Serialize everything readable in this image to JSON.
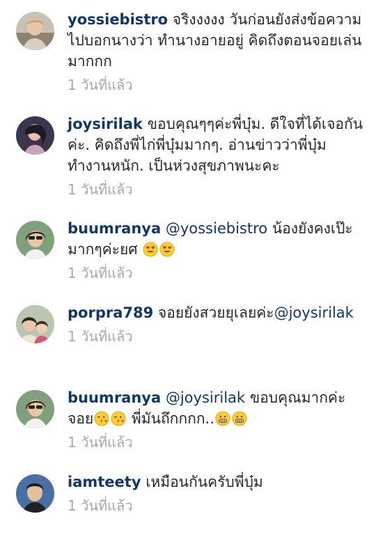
{
  "comments": [
    {
      "username": "yossiebistro",
      "mention": "",
      "text": "จริงงงงง วันก่อนยังส่งข้อความไปบอกนางว่า ทำนางอายอยู่ คิดถึงตอนจอยเล่นมากกก",
      "time": "1 วันที่แล้ว"
    },
    {
      "username": "joysirilak",
      "mention": "",
      "text": "ขอบคุณๆๆค่ะพี่บุ๋ม. ดีใจที่ได้เจอกันค่ะ. คิดถึงพี่ไก่พี่บุ๋มมากๆ. อ่านข่าวว่าพี่บุ๋มทำงานหนัก. เป็นห่วงสุขภาพนะคะ",
      "time": "1 วันที่แล้ว"
    },
    {
      "username": "buumranya",
      "mention": "@yossiebistro",
      "text": "น้องยังคงเป๊ะมากๆค่ะยศ",
      "emoji": [
        "heart-eyes-emoji",
        "heart-eyes-emoji"
      ],
      "time": "1 วันที่แล้ว"
    },
    {
      "username": "porpra789",
      "text": "จอยยังสวยยุเลยค่ะ",
      "mention": "@joysirilak",
      "time": "1 วันที่แล้ว"
    },
    {
      "username": "buumranya",
      "mention": "@joysirilak",
      "text": "ขอบคุณมากค่ะจอย",
      "emoji_mid": [
        "kissing-heart-emoji",
        "kissing-heart-emoji"
      ],
      "text2": "พี่มันถึกกกก..",
      "emoji_end": [
        "grimacing-emoji",
        "grimacing-emoji"
      ],
      "time": "1 วันที่แล้ว"
    },
    {
      "username": "iamteety",
      "mention": "",
      "text": "เหมือนกันครับพี่บุ๋ม",
      "time": "1 วันที่แล้ว"
    }
  ],
  "colors": {
    "username": "#12386a",
    "text": "#262626",
    "time": "#a8a8a8"
  }
}
